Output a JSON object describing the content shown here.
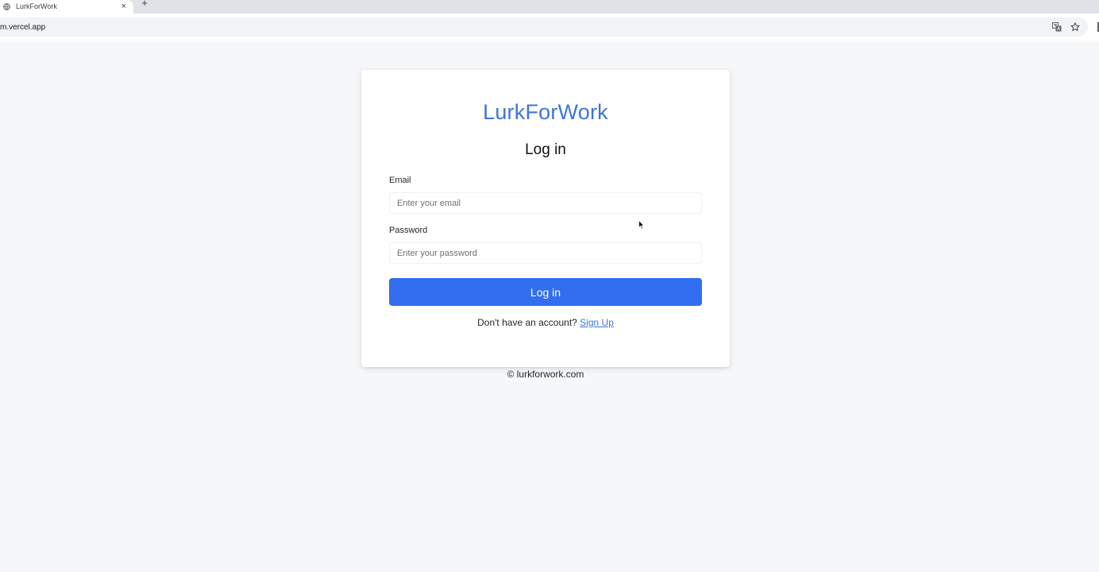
{
  "browser": {
    "tab_title": "LurkForWork",
    "tab_close": "×",
    "new_tab": "+",
    "url": "m.vercel.app",
    "icons": [
      "globe-icon",
      "close-icon",
      "plus-icon",
      "translate-icon",
      "star-icon"
    ]
  },
  "login": {
    "brand": "LurkForWork",
    "heading": "Log in",
    "email_label": "Email",
    "email_placeholder": "Enter your email",
    "email_value": "",
    "password_label": "Password",
    "password_placeholder": "Enter your password",
    "password_value": "",
    "submit_label": "Log in",
    "signup_prompt": "Don't have an account? ",
    "signup_link": "Sign Up"
  },
  "footer": {
    "text": "© lurkforwork.com"
  },
  "colors": {
    "brand": "#3d74d9",
    "button": "#326ff0",
    "page_background": "#f6f7f9"
  }
}
